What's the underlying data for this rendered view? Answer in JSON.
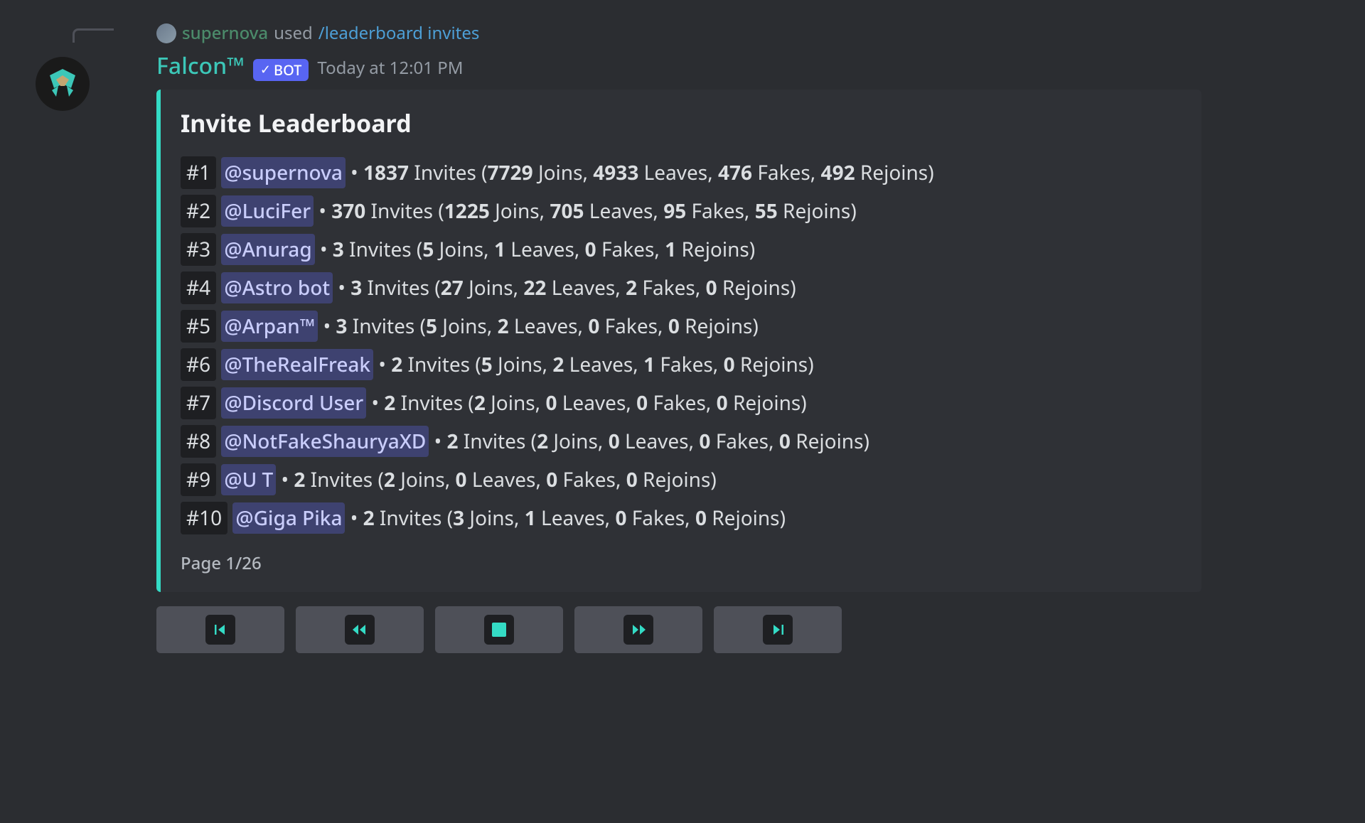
{
  "reply": {
    "user": "supernova",
    "used_text": "used",
    "command": "/leaderboard invites"
  },
  "bot": {
    "name": "Falcon™",
    "badge_label": "BOT",
    "timestamp": "Today at 12:01 PM"
  },
  "embed": {
    "title": "Invite Leaderboard",
    "footer": "Page 1/26"
  },
  "labels": {
    "invites": "Invites",
    "joins": "Joins",
    "leaves": "Leaves",
    "fakes": "Fakes",
    "rejoins": "Rejoins"
  },
  "leaderboard": [
    {
      "rank": "#1",
      "user": "@supernova",
      "invites": "1837",
      "joins": "7729",
      "leaves": "4933",
      "fakes": "476",
      "rejoins": "492"
    },
    {
      "rank": "#2",
      "user": "@LuciFer",
      "invites": "370",
      "joins": "1225",
      "leaves": "705",
      "fakes": "95",
      "rejoins": "55"
    },
    {
      "rank": "#3",
      "user": "@Anurag",
      "invites": "3",
      "joins": "5",
      "leaves": "1",
      "fakes": "0",
      "rejoins": "1"
    },
    {
      "rank": "#4",
      "user": "@Astro bot",
      "invites": "3",
      "joins": "27",
      "leaves": "22",
      "fakes": "2",
      "rejoins": "0"
    },
    {
      "rank": "#5",
      "user": "@Arpan™",
      "invites": "3",
      "joins": "5",
      "leaves": "2",
      "fakes": "0",
      "rejoins": "0"
    },
    {
      "rank": "#6",
      "user": "@TheRealFreak",
      "invites": "2",
      "joins": "5",
      "leaves": "2",
      "fakes": "1",
      "rejoins": "0"
    },
    {
      "rank": "#7",
      "user": "@Discord User",
      "invites": "2",
      "joins": "2",
      "leaves": "0",
      "fakes": "0",
      "rejoins": "0"
    },
    {
      "rank": "#8",
      "user": "@NotFakeShauryaXD",
      "invites": "2",
      "joins": "2",
      "leaves": "0",
      "fakes": "0",
      "rejoins": "0"
    },
    {
      "rank": "#9",
      "user": "@U T",
      "invites": "2",
      "joins": "2",
      "leaves": "0",
      "fakes": "0",
      "rejoins": "0"
    },
    {
      "rank": "#10",
      "user": "@Giga Pika",
      "invites": "2",
      "joins": "3",
      "leaves": "1",
      "fakes": "0",
      "rejoins": "0"
    }
  ],
  "buttons": {
    "first": "first-page",
    "prev": "previous-page",
    "stop": "stop",
    "next": "next-page",
    "last": "last-page"
  }
}
